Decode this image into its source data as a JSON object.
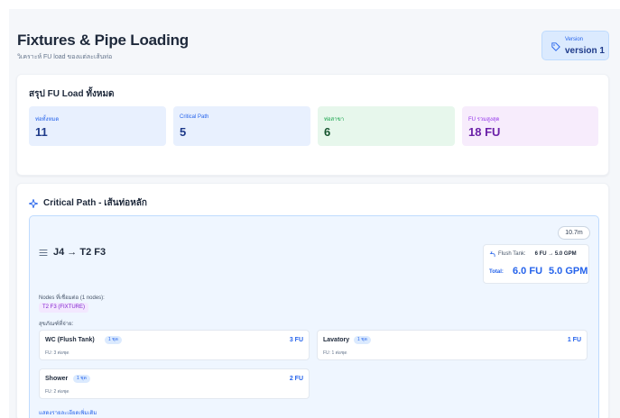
{
  "header": {
    "title": "Fixtures & Pipe Loading",
    "subtitle": "วิเคราะห์ FU load ของแต่ละเส้นท่อ",
    "version_label": "Version",
    "version_value": "version 1"
  },
  "summary": {
    "heading": "สรุป FU Load ทั้งหมด",
    "stats": [
      {
        "label": "ท่อทั้งหมด",
        "value": "11",
        "bg": "#e8f0fe",
        "label_color": "#2563eb",
        "value_color": "#1e3a8a"
      },
      {
        "label": "Critical Path",
        "value": "5",
        "bg": "#e8f0fe",
        "label_color": "#2563eb",
        "value_color": "#1e3a8a"
      },
      {
        "label": "ท่อสาขา",
        "value": "6",
        "bg": "#e7f7ec",
        "label_color": "#16a34a",
        "value_color": "#14532d"
      },
      {
        "label": "FU รวมสูงสุด",
        "value": "18 FU",
        "bg": "#f7ecfc",
        "label_color": "#9333ea",
        "value_color": "#6b21a8"
      }
    ]
  },
  "critical_path": {
    "heading": "Critical Path - เส้นท่อหลัก",
    "distance": "10.7m",
    "path_title": "J4 → T2 F3",
    "fu_row_label": "Flush Tank:",
    "fu_row_value": "6 FU → 5.0 GPM",
    "total_label": "Total:",
    "total_fu": "6.0 FU",
    "total_gpm": "5.0 GPM",
    "nodes_label": "Nodes ที่เชื่อมต่อ (1 nodes):",
    "node_chip": "T2 F3 (FIXTURE)",
    "fixtures_label": "สุขภัณฑ์ที่จ่าย:",
    "fixtures": [
      {
        "name": "WC (Flush Tank)",
        "count": "1 ชุด",
        "fu": "3 FU",
        "sub": "FU: 3 ต่อชุด"
      },
      {
        "name": "Lavatory",
        "count": "1 ชุด",
        "fu": "1 FU",
        "sub": "FU: 1 ต่อชุด"
      },
      {
        "name": "Shower",
        "count": "1 ชุด",
        "fu": "2 FU",
        "sub": "FU: 2 ต่อชุด"
      }
    ],
    "more_link": "แสดงรายละเอียดเพิ่มเติม"
  },
  "colors": {
    "accent": "#2563eb",
    "panel_bg": "#eff6ff",
    "chip_purple": "#7e22ce"
  },
  "icons": [
    "tag-icon",
    "sparkle-icon",
    "menu-lines-icon",
    "faucet-icon"
  ]
}
